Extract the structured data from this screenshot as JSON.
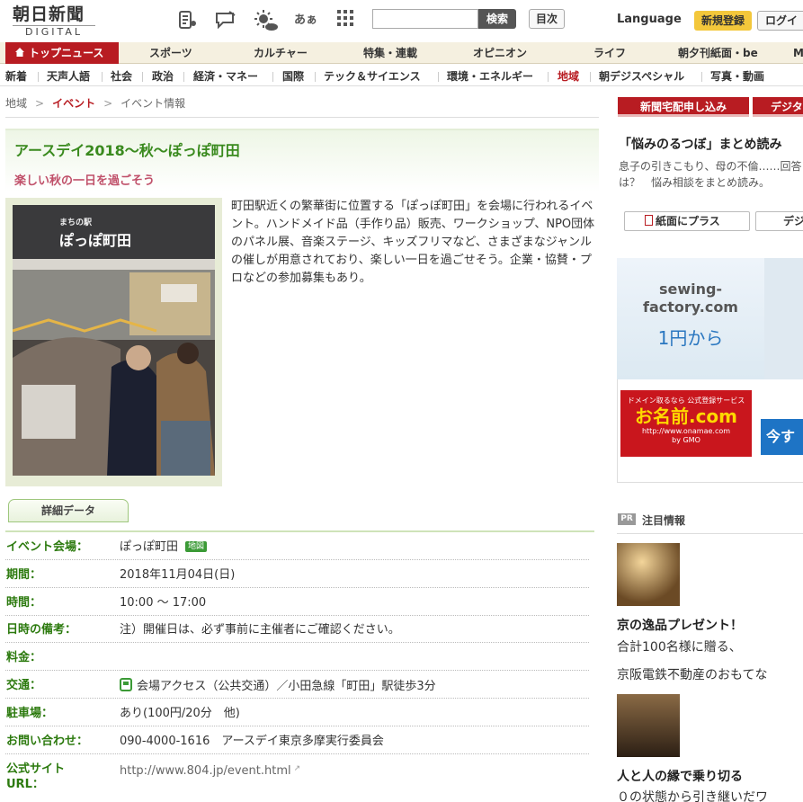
{
  "header": {
    "logo_main": "朝日新聞",
    "logo_sub": "DIGITAL",
    "search_button": "検索",
    "toc_button": "目次",
    "language": "Language",
    "register": "新規登録",
    "login": "ログイ",
    "font_size_glyph": "あぁ"
  },
  "nav1": [
    "トップニュース",
    "スポーツ",
    "カルチャー",
    "特集・連載",
    "オピニオン",
    "ライフ",
    "朝夕刊紙面・be",
    "M"
  ],
  "nav2": [
    "新着",
    "天声人語",
    "社会",
    "政治",
    "経済・マネー",
    "国際",
    "テック＆サイエンス",
    "環境・エネルギー",
    "地域",
    "朝デジスペシャル",
    "写真・動画"
  ],
  "breadcrumb": {
    "c1": "地域",
    "c2": "イベント",
    "c3": "イベント情報"
  },
  "event": {
    "title": "アースデイ2018～秋～ぽっぽ町田",
    "subtitle": "楽しい秋の一日を過ごそう",
    "description": "町田駅近くの繁華街に位置する「ぽっぽ町田」を会場に行われるイベント。ハンドメイド品（手作り品）販売、ワークショップ、NPO団体のパネル展、音楽ステージ、キッズフリマなど、さまざまなジャンルの催しが用意されており、楽しい一日を過ごせそう。企業・協賛・プロなどの参加募集もあり。",
    "photo_sign_small": "まちの駅",
    "photo_sign": "ぽっぽ町田"
  },
  "details": {
    "tab": "詳細データ",
    "map_badge": "地図",
    "rows": [
      {
        "label": "イベント会場：",
        "value": "ぽっぽ町田"
      },
      {
        "label": "期間：",
        "value": "2018年11月04日(日)"
      },
      {
        "label": "時間：",
        "value": "10:00 ～ 17:00"
      },
      {
        "label": "日時の備考：",
        "value": "注）開催日は、必ず事前に主催者にご確認ください。"
      },
      {
        "label": "料金：",
        "value": ""
      },
      {
        "label": "交通：",
        "value": "会場アクセス（公共交通）／小田急線「町田」駅徒歩3分"
      },
      {
        "label": "駐車場：",
        "value": "あり(100円/20分　他)"
      },
      {
        "label": "お問い合わせ：",
        "value": "090-4000-1616　アースデイ東京多摩実行委員会"
      },
      {
        "label": "公式サイト",
        "value": "http://www.804.jp/event.html"
      },
      {
        "label": "URL：",
        "value": ""
      }
    ]
  },
  "sidebar": {
    "ad1": "新聞宅配申し込み",
    "ad1b": "デジタ",
    "nayami_title": "「悩みのるつぼ」まとめ読み",
    "nayami_text": "息子の引きこもり、母の不倫……回答は？　悩み相談をまとめ読み。",
    "kami_button": "紙面にプラス",
    "digi_button": "デジ",
    "sf_line1": "sewing-",
    "sf_line2": "factory.com",
    "sf_price": "1円から",
    "onamae_t1": "ドメイン取るなら 公式登録サービス",
    "onamae_t2": "お名前.com",
    "onamae_t3": "http://www.onamae.com",
    "onamae_t4": "by GMO",
    "imasu": "今す",
    "pr_badge": "PR",
    "pr_title": "注目情報",
    "pr1_h": "京の逸品プレゼント！",
    "pr1_t1": "合計100名様に贈る、",
    "pr1_t2": "京阪電鉄不動産のおもてな",
    "pr2_h": "人と人の縁で乗り切る",
    "pr2_t1": "０の状態から引き継いだワ"
  }
}
